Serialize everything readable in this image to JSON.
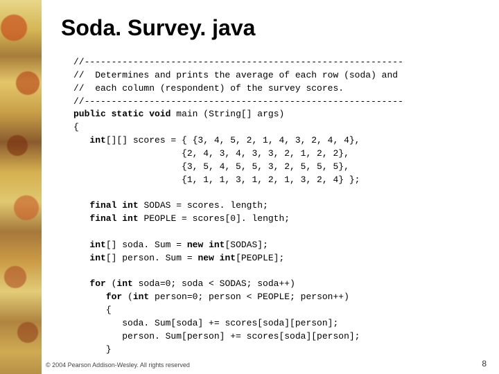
{
  "title": "Soda. Survey. java",
  "code": {
    "line01": "//-----------------------------------------------------------",
    "line02a": "//  Determines and prints the average of each row (soda) and",
    "line02b": "//  each column (respondent) of the survey scores.",
    "line03": "//-----------------------------------------------------------",
    "kw_public": "public",
    "kw_static": "static",
    "kw_void": "void",
    "main_sig": " main (String[] args)",
    "lbrace": "{",
    "kw_int": "int",
    "scores_decl": "[][] scores = { {3, 4, 5, 2, 1, 4, 3, 2, 4, 4},",
    "scores_row2": "                    {2, 4, 3, 4, 3, 3, 2, 1, 2, 2},",
    "scores_row3": "                    {3, 5, 4, 5, 5, 3, 2, 5, 5, 5},",
    "scores_row4": "                    {1, 1, 1, 3, 1, 2, 1, 3, 2, 4} };",
    "kw_final": "final",
    "sodas_decl": " SODAS = scores. length;",
    "people_decl": " PEOPLE = scores[0]. length;",
    "sodasum_a": "[] soda. Sum = ",
    "kw_new": "new",
    "sodasum_b": "[SODAS];",
    "personsum_a": "[] person. Sum = ",
    "personsum_b": "[PEOPLE];",
    "kw_for": "for",
    "for1_a": " (",
    "for1_b": " soda=0; soda < SODAS; soda++)",
    "for2_a": " (",
    "for2_b": " person=0; person < PEOPLE; person++)",
    "inner1": "      soda. Sum[soda] += scores[soda][person];",
    "inner2": "      person. Sum[person] += scores[soda][person];",
    "rbrace": "   }"
  },
  "footer": "© 2004 Pearson Addison-Wesley. All rights reserved",
  "pagenum": "8"
}
